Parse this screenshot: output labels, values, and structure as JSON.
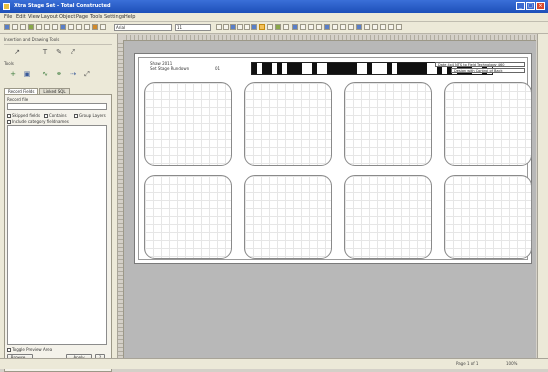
{
  "window": {
    "title": "Xtra Stage Set - Total Constructed"
  },
  "menu": [
    "File",
    "Edit",
    "View",
    "Layout",
    "Object",
    "Page",
    "Tools",
    "Settings",
    "Help"
  ],
  "toolbar": {
    "font_name": "Arial",
    "font_size": "11"
  },
  "left_panel": {
    "drawing_tools_header": "Insertion and Drawing Tools",
    "tools_label": "Tools",
    "tabs": [
      "Record Fields",
      "Linked SQL"
    ],
    "fields_label": "Record file",
    "checkboxes": [
      "Skipped fields",
      "Contains",
      "Group Layers",
      "Include category fieldnames"
    ],
    "bottom_checkbox": "Toggle Preview Area",
    "buttons": {
      "browse": "Browse...",
      "apply": "Apply",
      "help": "?"
    }
  },
  "page": {
    "header_line1": "Shaw 2011",
    "header_line2": "Set Stage Rundown",
    "header_value": "01",
    "option1": "Date 4x4 NTS to Field Technology 460",
    "option2": "Design with Control of Back"
  },
  "barcode": [
    1,
    1,
    2,
    1,
    1,
    1,
    3,
    2,
    1,
    2,
    6,
    2,
    1,
    3,
    1,
    1,
    6,
    2,
    1,
    1,
    1,
    1,
    3,
    2,
    1,
    1
  ],
  "cards": {
    "rows": 2,
    "cols": 4
  },
  "status": {
    "page": "Page 1 of 1",
    "zoom": "100%"
  }
}
